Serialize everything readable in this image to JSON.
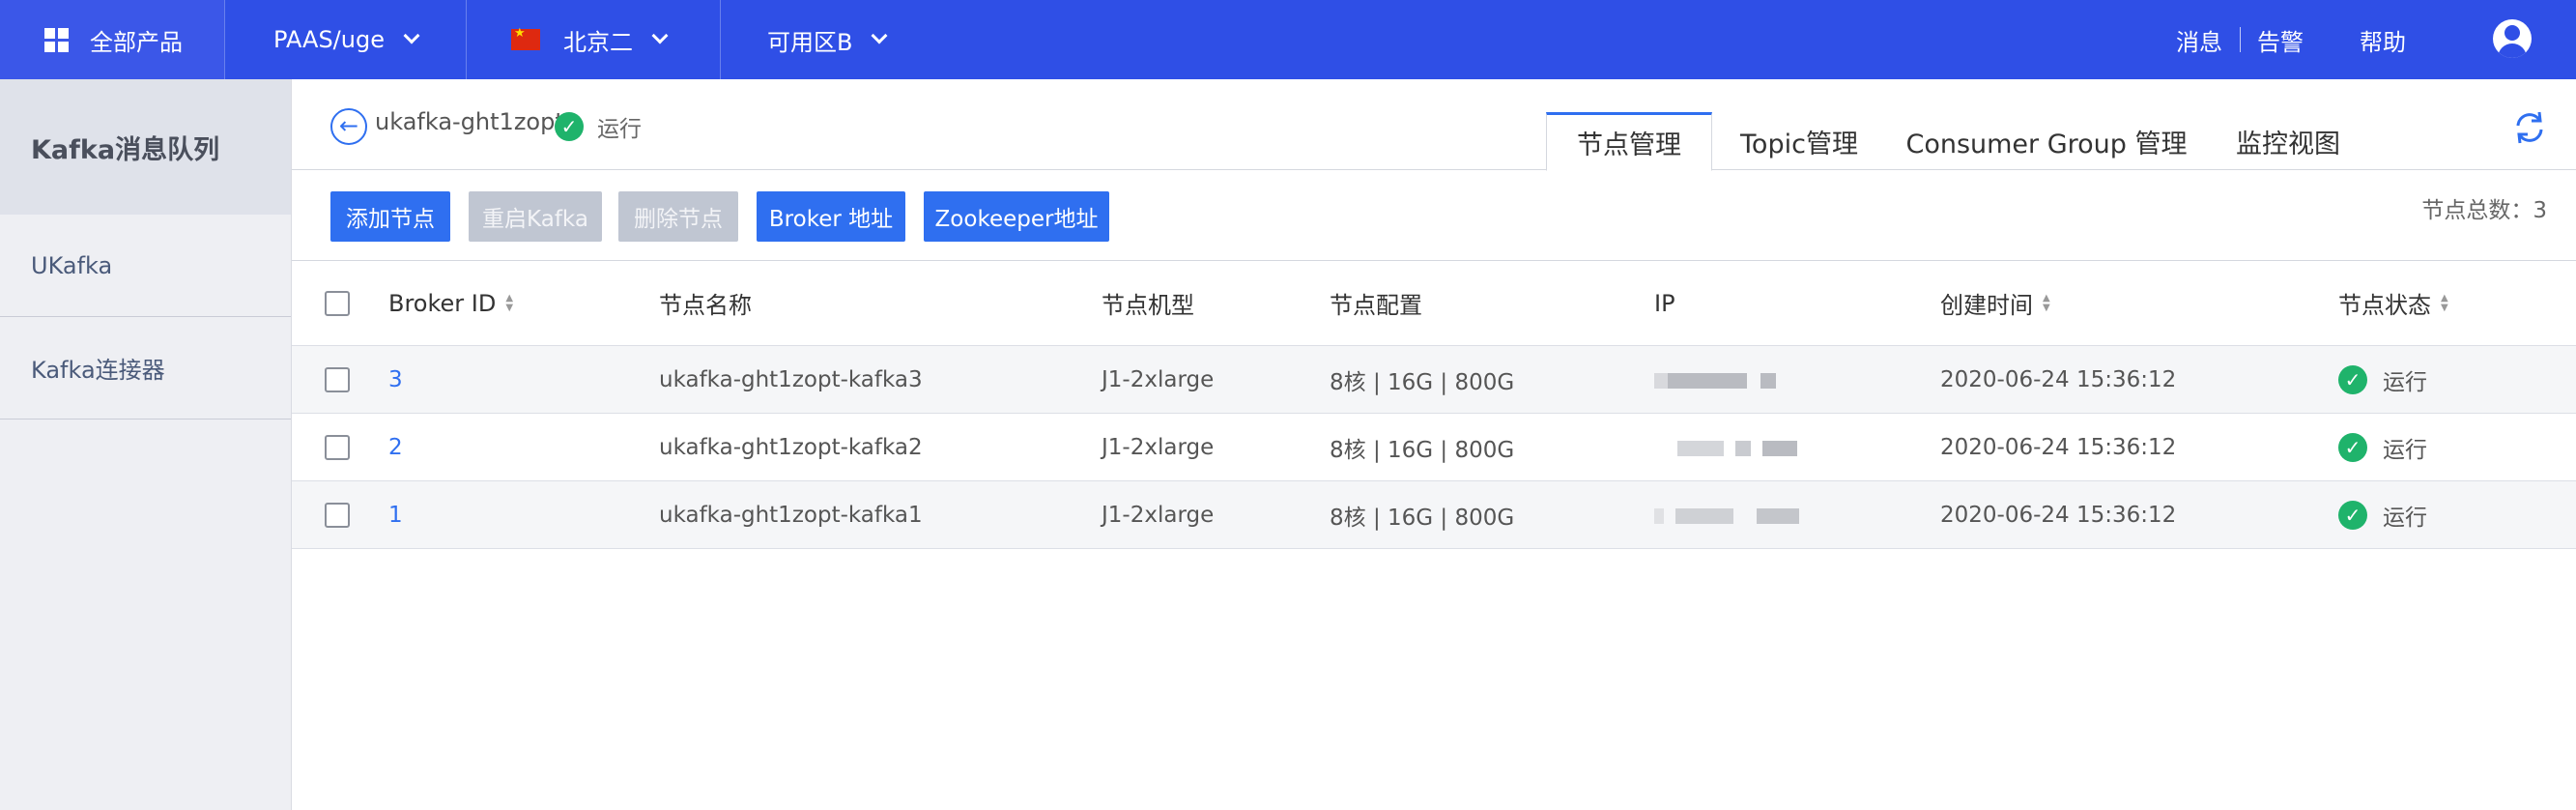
{
  "topbar": {
    "products_label": "全部产品",
    "project_label": "PAAS/uge",
    "region_label": "北京二",
    "zone_label": "可用区B",
    "messages_label": "消息",
    "alerts_label": "告警",
    "help_label": "帮助",
    "bg_color": "#2f4fe6"
  },
  "sidebar": {
    "title": "Kafka消息队列",
    "items": [
      {
        "label": "UKafka"
      },
      {
        "label": "Kafka连接器"
      }
    ]
  },
  "instance": {
    "name": "ukafka-ght1zopt",
    "status": "运行"
  },
  "tabs": [
    {
      "label": "节点管理",
      "active": true
    },
    {
      "label": "Topic管理",
      "active": false
    },
    {
      "label": "Consumer Group 管理",
      "active": false
    },
    {
      "label": "监控视图",
      "active": false
    }
  ],
  "toolbar": {
    "add_node": "添加节点",
    "restart_kafka": "重启Kafka",
    "delete_node": "删除节点",
    "broker_address": "Broker 地址",
    "zookeeper_address": "Zookeeper地址",
    "node_total": "节点总数：3",
    "accent_color": "#2f6ff0"
  },
  "table": {
    "columns": {
      "broker_id": "Broker ID",
      "node_name": "节点名称",
      "node_type": "节点机型",
      "node_config": "节点配置",
      "ip": "IP",
      "created_at": "创建时间",
      "node_state": "节点状态"
    },
    "rows": [
      {
        "broker_id": "3",
        "node_name": "ukafka-ght1zopt-kafka3",
        "node_type": "J1-2xlarge",
        "node_config": "8核 | 16G | 800G",
        "created_at": "2020-06-24 15:36:12",
        "state": "运行"
      },
      {
        "broker_id": "2",
        "node_name": "ukafka-ght1zopt-kafka2",
        "node_type": "J1-2xlarge",
        "node_config": "8核 | 16G | 800G",
        "created_at": "2020-06-24 15:36:12",
        "state": "运行"
      },
      {
        "broker_id": "1",
        "node_name": "ukafka-ght1zopt-kafka1",
        "node_type": "J1-2xlarge",
        "node_config": "8核 | 16G | 800G",
        "created_at": "2020-06-24 15:36:12",
        "state": "运行"
      }
    ]
  },
  "icons": {
    "products": "grid-icon",
    "dropdown": "chevron-down-icon",
    "region_flag": "china-flag-icon",
    "avatar": "user-avatar-icon",
    "back": "back-arrow-icon",
    "status_ok": "check-circle-icon",
    "refresh": "refresh-icon",
    "sort": "sort-icon"
  }
}
